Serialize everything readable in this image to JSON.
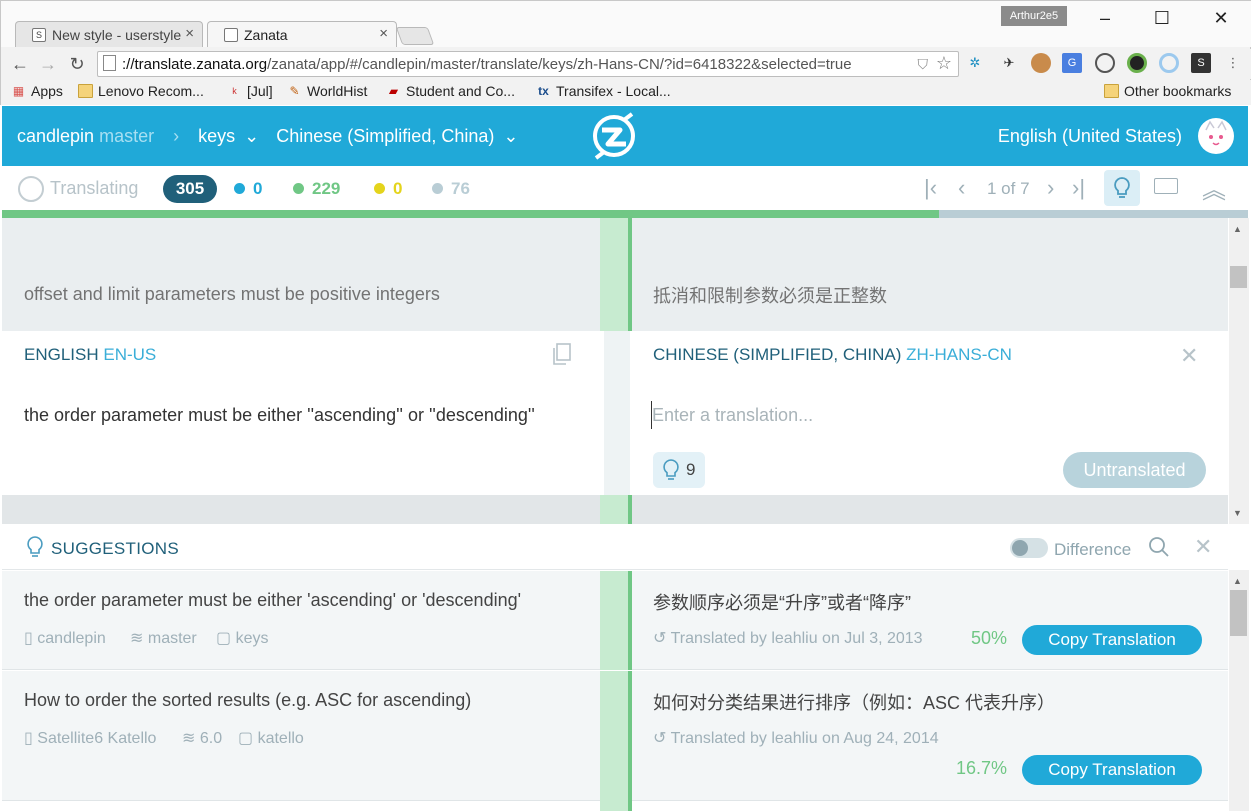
{
  "browser": {
    "tabs": [
      {
        "title": "New style - userstyle"
      },
      {
        "title": "Zanata"
      }
    ],
    "profile": "Arthur2e5",
    "url_host": "://translate.zanata.org",
    "url_path": "/zanata/app/#/candlepin/master/translate/keys/zh-Hans-CN/?id=6418322&selected=true",
    "bookmarks": [
      "Apps",
      "Lenovo Recom...",
      "[Jul]",
      "WorldHist",
      "Student and Co...",
      "Transifex - Local..."
    ],
    "bookmarks_other": "Other bookmarks"
  },
  "app": {
    "project": "candlepin",
    "version": "master",
    "document": "keys",
    "target_language": "Chinese (Simplified, China)",
    "ui_language": "English (United States)"
  },
  "status": {
    "mode": "Translating",
    "total": "305",
    "needs_review": "0",
    "translated": "229",
    "fuzzy": "0",
    "untranslated": "76",
    "page": "1 of 7",
    "progress_translated": 0.752,
    "colors": {
      "translated": "#70c785",
      "review": "#20a9d8",
      "fuzzy": "#e4d41c",
      "untranslated": "#b9cdd5"
    }
  },
  "editor": {
    "previous_source": "offset and limit parameters must be positive integers",
    "previous_target": "抵消和限制参数必须是正整数",
    "source_lang": "ENGLISH",
    "source_code": "EN-US",
    "target_lang": "CHINESE (SIMPLIFIED, CHINA)",
    "target_code": "ZH-HANS-CN",
    "source_text": "the order parameter must be either ''ascending'' or ''descending''",
    "target_placeholder": "Enter a translation...",
    "suggestion_count": "9",
    "state_button": "Untranslated"
  },
  "suggestions": {
    "title": "SUGGESTIONS",
    "difference_label": "Difference",
    "items": [
      {
        "source": "the order parameter must be either 'ascending' or 'descending'",
        "target": "参数顺序必须是“升序”或者“降序”",
        "project": "candlepin",
        "version": "master",
        "document": "keys",
        "by": "Translated by leahliu on Jul 3, 2013",
        "match": "50%",
        "copy_label": "Copy Translation"
      },
      {
        "source": "How to order the sorted results (e.g. ASC for ascending)",
        "target": "如何对分类结果进行排序（例如：ASC 代表升序）",
        "project": "Satellite6 Katello",
        "version": "6.0",
        "document": "katello",
        "by": "Translated by leahliu on Aug 24, 2014",
        "match": "16.7%",
        "copy_label": "Copy Translation"
      }
    ]
  }
}
